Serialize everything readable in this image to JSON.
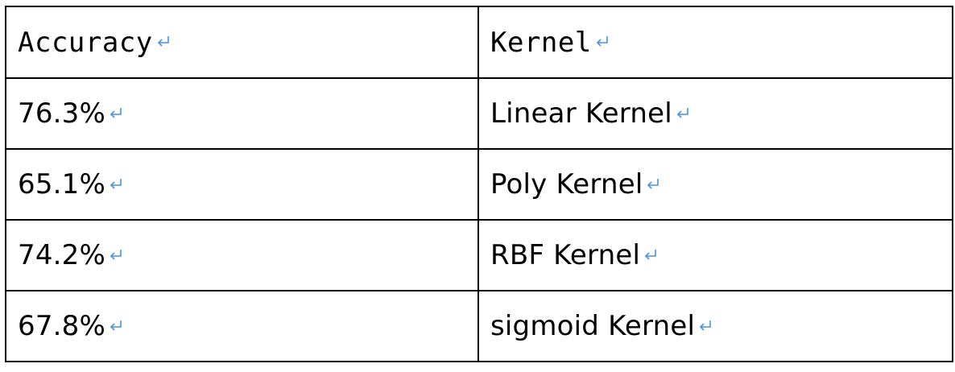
{
  "table": {
    "headers": [
      {
        "text": "Accuracy",
        "mono": true
      },
      {
        "text": "Kernel",
        "mono": true
      }
    ],
    "rows": [
      {
        "accuracy": "76.3%",
        "kernel": "Linear Kernel"
      },
      {
        "accuracy": "65.1%",
        "kernel": "Poly Kernel"
      },
      {
        "accuracy": "74.2%",
        "kernel": "RBF Kernel"
      },
      {
        "accuracy": "67.8%",
        "kernel": "sigmoid Kernel"
      }
    ]
  },
  "colors": {
    "border": "#000000",
    "paragraph_mark": "#4a90e2",
    "text": "#000000"
  },
  "icons": {
    "paragraph_mark": "return-arrow-icon"
  }
}
